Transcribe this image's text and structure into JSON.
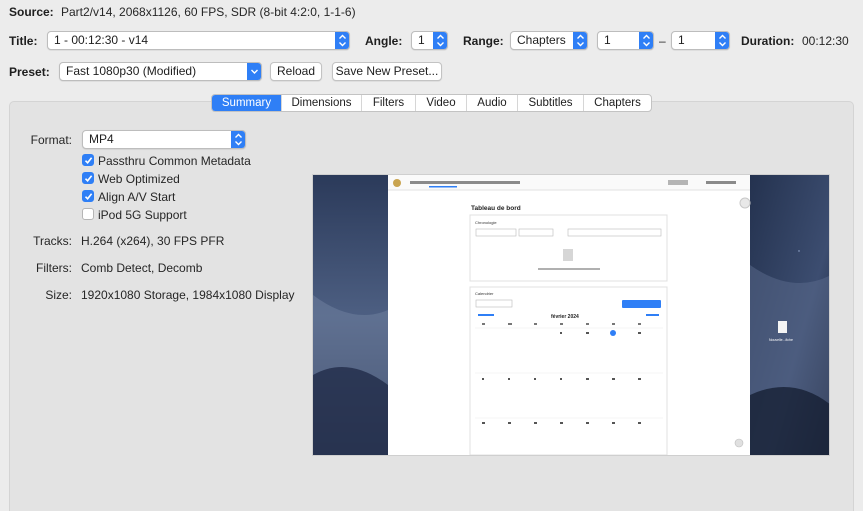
{
  "source": {
    "label": "Source:",
    "value": "Part2/v14, 2068x1126, 60 FPS, SDR (8-bit 4:2:0, 1-1-6)"
  },
  "title_row": {
    "title_label": "Title:",
    "title_value": "1 - 00:12:30 - v14",
    "angle_label": "Angle:",
    "angle_value": "1",
    "range_label": "Range:",
    "range_type": "Chapters",
    "range_start": "1",
    "range_sep": "–",
    "range_end": "1",
    "duration_label": "Duration:",
    "duration_value": "00:12:30"
  },
  "preset_row": {
    "preset_label": "Preset:",
    "preset_value": "Fast 1080p30 (Modified)",
    "reload_label": "Reload",
    "save_label": "Save New Preset..."
  },
  "tabs": [
    {
      "label": "Summary",
      "active": true
    },
    {
      "label": "Dimensions",
      "active": false
    },
    {
      "label": "Filters",
      "active": false
    },
    {
      "label": "Video",
      "active": false
    },
    {
      "label": "Audio",
      "active": false
    },
    {
      "label": "Subtitles",
      "active": false
    },
    {
      "label": "Chapters",
      "active": false
    }
  ],
  "summary": {
    "format_label": "Format:",
    "format_value": "MP4",
    "options": [
      {
        "label": "Passthru Common Metadata",
        "checked": true
      },
      {
        "label": "Web Optimized",
        "checked": true
      },
      {
        "label": "Align A/V Start",
        "checked": true
      },
      {
        "label": "iPod 5G Support",
        "checked": false
      }
    ],
    "tracks_label": "Tracks:",
    "tracks_value": "H.264 (x264), 30 FPS PFR",
    "filters_label": "Filters:",
    "filters_value": "Comb Detect, Decomb",
    "size_label": "Size:",
    "size_value": "1920x1080 Storage, 1984x1080 Display"
  },
  "preview": {
    "page_heading": "Tableau de bord",
    "section1": "Chronologie",
    "section2": "Calendrier",
    "month": "février 2024",
    "desktop_file": "Nouvelle...fiche"
  },
  "colors": {
    "accent": "#2f7ff6",
    "window_bg": "#ececec",
    "panel_bg": "#e3e3e3"
  }
}
